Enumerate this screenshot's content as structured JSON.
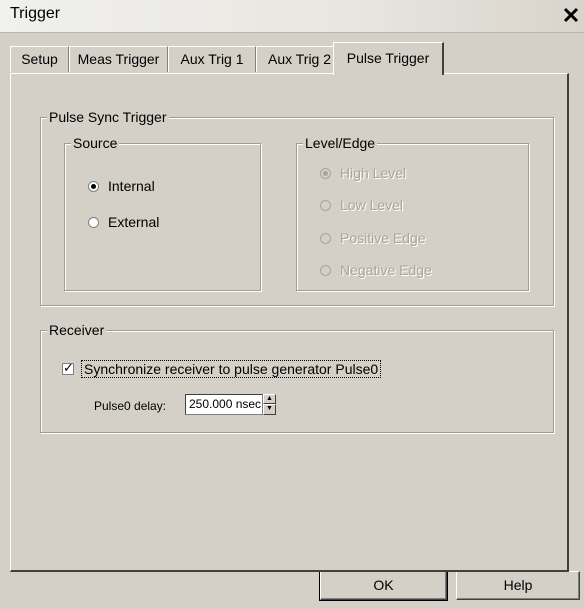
{
  "window": {
    "title": "Trigger",
    "close_glyph": "✕"
  },
  "tabs": [
    {
      "label": "Setup"
    },
    {
      "label": "Meas Trigger"
    },
    {
      "label": "Aux Trig 1"
    },
    {
      "label": "Aux Trig 2"
    },
    {
      "label": "Pulse Trigger",
      "active": true
    }
  ],
  "pulse_sync": {
    "title": "Pulse Sync Trigger",
    "source": {
      "title": "Source",
      "options": [
        {
          "label": "Internal",
          "checked": true
        },
        {
          "label": "External",
          "checked": false
        }
      ]
    },
    "level_edge": {
      "title": "Level/Edge",
      "options": [
        {
          "label": "High Level",
          "checked": true,
          "enabled": false
        },
        {
          "label": "Low Level",
          "checked": false,
          "enabled": false
        },
        {
          "label": "Positive Edge",
          "checked": false,
          "enabled": false
        },
        {
          "label": "Negative Edge",
          "checked": false,
          "enabled": false
        }
      ]
    }
  },
  "receiver": {
    "title": "Receiver",
    "sync_checkbox": {
      "label": "Synchronize receiver to pulse generator Pulse0",
      "checked": true
    },
    "delay": {
      "label": "Pulse0 delay:",
      "value": "250.000 nsec"
    }
  },
  "buttons": {
    "ok": "OK",
    "help": "Help"
  }
}
